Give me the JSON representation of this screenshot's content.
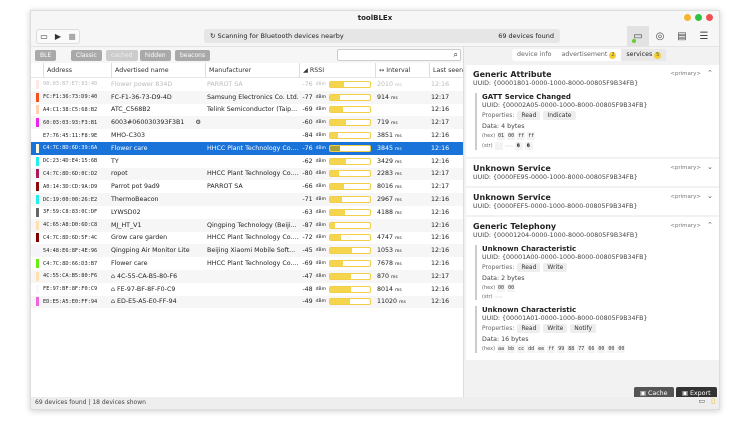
{
  "window": {
    "title": "toolBLEx"
  },
  "toolbar": {
    "scan_status": "Scanning for Bluetooth devices nearby",
    "devices_found": "69 devices found"
  },
  "filters": [
    "BLE",
    "Classic",
    "cached",
    "hidden",
    "beacons"
  ],
  "search": {
    "placeholder": "",
    "icon": "search-icon"
  },
  "columns": [
    "Address",
    "Advertised name",
    "Manufacturer",
    "RSSI",
    "Interval",
    "Last seen"
  ],
  "devices": [
    {
      "addr": "90:03:B7:E7:83:40",
      "name": "Flower power 834D",
      "mfr": "PARROT SA",
      "rssi": -76,
      "level": 0.36,
      "interval": "2010",
      "seen": "12:16",
      "color": "#fde8e8",
      "faded": true
    },
    {
      "addr": "FC:F1:36:73:D9:40",
      "name": "FC-F1-36-73-D9-4D",
      "mfr": "Samsung Electronics Co. Ltd.",
      "rssi": -77,
      "level": 0.25,
      "interval": "914",
      "seen": "12:17",
      "color": "#f4511e"
    },
    {
      "addr": "A4:C1:38:C5:68:B2",
      "name": "ATC_C568B2",
      "mfr": "Telink Semiconductor (Taip...",
      "rssi": -69,
      "level": 0.32,
      "interval": "",
      "seen": "12:16",
      "color": "#ffd0b0"
    },
    {
      "addr": "60:03:03:93:F3:B1",
      "name": "6003#060030393F3B1",
      "mfr": "",
      "rssi": -60,
      "level": 0.4,
      "interval": "719",
      "seen": "12:17",
      "color": "#ee22ee",
      "gear": true
    },
    {
      "addr": "E7:76:45:11:F8:9E",
      "name": "MHO-C303",
      "mfr": "",
      "rssi": -84,
      "level": 0.2,
      "interval": "3851",
      "seen": "12:16",
      "color": "#ffffff"
    },
    {
      "addr": "C4:7C:8D:6D:39:6A",
      "name": "Flower care",
      "mfr": "HHCC Plant Technology Co....",
      "rssi": -76,
      "level": 0.26,
      "interval": "3845",
      "seen": "12:16",
      "color": "#fff8dd",
      "selected": true
    },
    {
      "addr": "DC:23:4D:E4:15:6B",
      "name": "TY",
      "mfr": "",
      "rssi": -62,
      "level": 0.4,
      "interval": "3429",
      "seen": "12:16",
      "color": "#22eeee"
    },
    {
      "addr": "C4:7C:8D:6D:0C:D2",
      "name": "ropot",
      "mfr": "HHCC Plant Technology Co....",
      "rssi": -80,
      "level": 0.22,
      "interval": "2283",
      "seen": "12:17",
      "color": "#b0185c"
    },
    {
      "addr": "A0:14:3D:CD:9A:D9",
      "name": "Parrot pot 9ad9",
      "mfr": "PARROT SA",
      "rssi": -66,
      "level": 0.35,
      "interval": "8016",
      "seen": "12:17",
      "color": "#8b0a0a"
    },
    {
      "addr": "DC:19:00:00:26:E2",
      "name": "ThermoBeacon",
      "mfr": "",
      "rssi": -71,
      "level": 0.3,
      "interval": "2967",
      "seen": "12:16",
      "color": "#22eeee"
    },
    {
      "addr": "3F:59:C8:83:0C:DF",
      "name": "LYWSD02",
      "mfr": "",
      "rssi": -63,
      "level": 0.38,
      "interval": "4188",
      "seen": "12:16",
      "color": "#666666"
    },
    {
      "addr": "4C:65:A8:D0:6D:C8",
      "name": "MJ_HT_V1",
      "mfr": "Qingping Technology (Beiji...",
      "rssi": -87,
      "level": 0.12,
      "interval": "",
      "seen": "12:16",
      "color": "#ffe0b0"
    },
    {
      "addr": "C4:7C:8D:6D:5F:4C",
      "name": "Grow care garden",
      "mfr": "HHCC Plant Technology Co....",
      "rssi": -72,
      "level": 0.28,
      "interval": "4747",
      "seen": "12:16",
      "color": "#800000"
    },
    {
      "addr": "54:48:E6:8F:4E:96",
      "name": "Qingping Air Monitor Lite",
      "mfr": "Beijing Xiaomi Mobile Soft...",
      "rssi": -45,
      "level": 0.55,
      "interval": "1053",
      "seen": "12:16",
      "color": "#f4f4ff"
    },
    {
      "addr": "C4:7C:8D:66:D3:B7",
      "name": "Flower care",
      "mfr": "HHCC Plant Technology Co....",
      "rssi": -69,
      "level": 0.32,
      "interval": "7678",
      "seen": "12:16",
      "color": "#66ee11"
    },
    {
      "addr": "4C:55:CA:B5:80:F6",
      "name": "4C-55-CA-B5-80-F6",
      "mfr": "",
      "rssi": -47,
      "level": 0.53,
      "interval": "870",
      "seen": "12:17",
      "color": "#ffe0b0",
      "tag": true
    },
    {
      "addr": "FE:97:BF:8F:F0:C9",
      "name": "FE-97-BF-8F-F0-C9",
      "mfr": "",
      "rssi": -48,
      "level": 0.52,
      "interval": "8014",
      "seen": "12:16",
      "color": "#f8f8ff",
      "tag": true
    },
    {
      "addr": "ED:E5:A5:E0:FF:94",
      "name": "ED-E5-A5-E0-FF-94",
      "mfr": "",
      "rssi": -49,
      "level": 0.51,
      "interval": "11020",
      "seen": "12:16",
      "color": "#ee66dd",
      "tag": true
    }
  ],
  "units": {
    "rssi": "dBm",
    "interval": "ms"
  },
  "statusbar": {
    "text": "69 devices found  |  18 devices shown"
  },
  "tabs": [
    {
      "label": "device info"
    },
    {
      "label": "advertisement",
      "badge": "2"
    },
    {
      "label": "services",
      "badge": "5"
    }
  ],
  "services": [
    {
      "name": "Generic Attribute",
      "uuid": "UUID: {00001801-0000-1000-8000-00805F9B34FB}",
      "type": "<primary>",
      "expanded": true,
      "chars": [
        {
          "name": "GATT Service Changed",
          "uuid": "UUID: {00002A05-0000-1000-8000-00805F9B34FB}",
          "props": [
            "Read",
            "Indicate"
          ],
          "data": "Data: 4 bytes",
          "hex": [
            "01",
            "00",
            "ff",
            "ff"
          ],
          "str": [
            "\u0001",
            "",
            "�",
            "�"
          ]
        }
      ]
    },
    {
      "name": "Unknown Service",
      "uuid": "UUID: {0000FE95-0000-1000-8000-00805F9B34FB}",
      "type": "<primary>",
      "chars": []
    },
    {
      "name": "Unknown Service",
      "uuid": "UUID: {0000FEF5-0000-1000-8000-00805F9B34FB}",
      "type": "<primary>",
      "chars": []
    },
    {
      "name": "Generic Telephony",
      "uuid": "UUID: {00001204-0000-1000-8000-00805F9B34FB}",
      "type": "<primary>",
      "expanded": true,
      "chars": [
        {
          "name": "Unknown Characteristic",
          "uuid": "UUID: {00001A00-0000-1000-8000-00805F9B34FB}",
          "props": [
            "Read",
            "Write"
          ],
          "data": "Data: 2 bytes",
          "hex": [
            "00",
            "00"
          ],
          "str": [
            ""
          ]
        },
        {
          "name": "Unknown Characteristic",
          "uuid": "UUID: {00001A01-0000-1000-8000-00805F9B34FB}",
          "props": [
            "Read",
            "Write",
            "Notify"
          ],
          "data": "Data: 16 bytes",
          "hex": [
            "aa",
            "bb",
            "cc",
            "dd",
            "ee",
            "ff",
            "99",
            "88",
            "77",
            "66",
            "00",
            "00",
            "00"
          ]
        }
      ]
    }
  ],
  "labels": {
    "properties": "Properties:",
    "hex": "(hex)",
    "str": "(str)"
  },
  "actions": {
    "cache": "Cache",
    "export": "Export"
  }
}
